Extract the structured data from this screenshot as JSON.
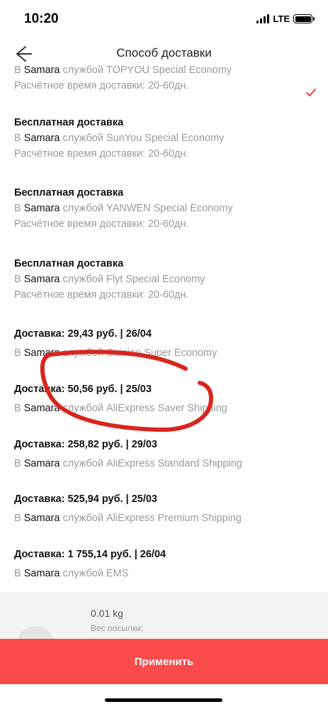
{
  "status_bar": {
    "time": "10:20",
    "network": "LTE"
  },
  "nav": {
    "title": "Способ доставки",
    "back_icon": "back-arrow-icon"
  },
  "options": [
    {
      "title": "",
      "city": "Samara",
      "line1_prefix": "В ",
      "line1_suffix": " службой TOPYOU Special Economy",
      "line2": "Расчётное время доставки: 20-60дн.",
      "selected": true
    },
    {
      "title": "Бесплатная доставка",
      "city": "Samara",
      "line1_prefix": "В ",
      "line1_suffix": " службой SunYou Special Economy",
      "line2": "Расчётное время доставки: 20-60дн.",
      "selected": false
    },
    {
      "title": "Бесплатная доставка",
      "city": "Samara",
      "line1_prefix": "В ",
      "line1_suffix": " службой YANWEN Special Economy",
      "line2": "Расчётное время доставки: 20-60дн.",
      "selected": false
    },
    {
      "title": "Бесплатная доставка",
      "city": "Samara",
      "line1_prefix": "В ",
      "line1_suffix": " службой Flyt Special Economy",
      "line2": "Расчётное время доставки: 20-60дн.",
      "selected": false
    },
    {
      "title": "Доставка: 29,43 руб. | 26/04",
      "city": "Samara",
      "line1_prefix": "В ",
      "line1_suffix": " службой Cainiao Super Economy",
      "line2": "",
      "selected": false
    },
    {
      "title": "Доставка: 50,56 руб. | 25/03",
      "city": "Samara",
      "line1_prefix": "В ",
      "line1_suffix": " службой AliExpress Saver Shipping",
      "line2": "",
      "selected": false
    },
    {
      "title": "Доставка: 258,82 руб. | 29/03",
      "city": "Samara",
      "line1_prefix": "В ",
      "line1_suffix": " службой AliExpress Standard Shipping",
      "line2": "",
      "selected": false
    },
    {
      "title": "Доставка: 525,94 руб. | 25/03",
      "city": "Samara",
      "line1_prefix": "В ",
      "line1_suffix": " службой AliExpress Premium Shipping",
      "line2": "",
      "selected": false
    },
    {
      "title": "Доставка: 1 755,14 руб. | 26/04",
      "city": "Samara",
      "line1_prefix": "В ",
      "line1_suffix": " службой EMS",
      "line2": "",
      "selected": false
    }
  ],
  "package": {
    "weight_value": "0.01 kg",
    "weight_label": "Вес посылки:"
  },
  "apply_label": "Применить",
  "colors": {
    "accent": "#fa4a4a",
    "check": "#e0473c",
    "annotation": "#d8261f",
    "secondary_text": "#9a9a9a"
  }
}
